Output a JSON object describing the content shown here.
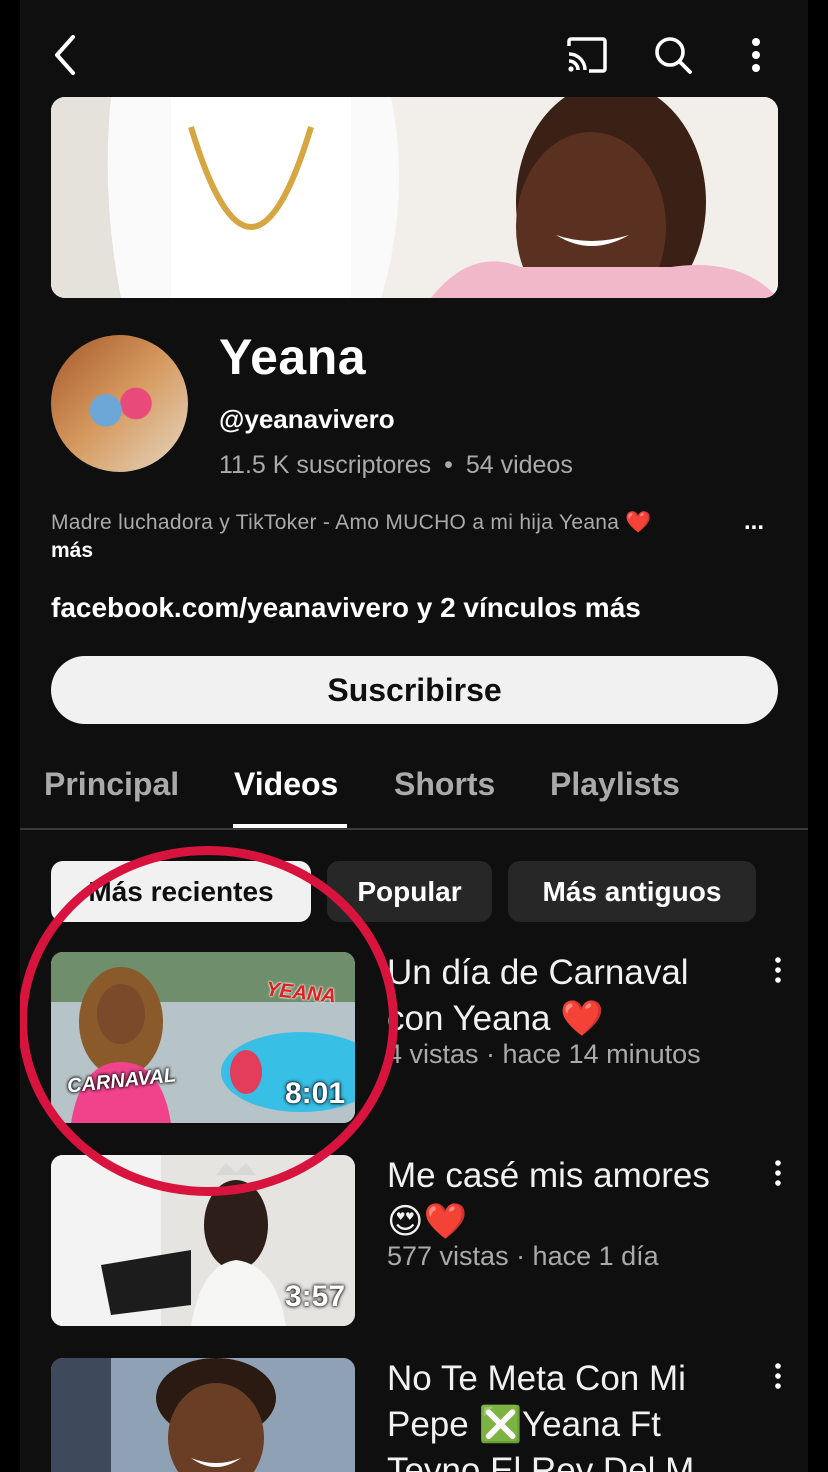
{
  "channel": {
    "name": "Yeana",
    "handle": "@yeanavivero",
    "subscribers": "11.5 K suscriptores",
    "separator": "•",
    "video_count": "54 videos",
    "description": "Madre luchadora y TikToker - Amo MUCHO a mi hija Yeana ❤️",
    "description_ellipsis": "...",
    "description_more": "más",
    "links_primary": "facebook.com/yeanavivero",
    "links_more": " y 2 vínculos más",
    "subscribe_label": "Suscribirse"
  },
  "tabs": [
    {
      "label": "Principal",
      "active": false
    },
    {
      "label": "Videos",
      "active": true
    },
    {
      "label": "Shorts",
      "active": false
    },
    {
      "label": "Playlists",
      "active": false
    }
  ],
  "chips": [
    {
      "label": "Más recientes",
      "selected": true
    },
    {
      "label": "Popular",
      "selected": false
    },
    {
      "label": "Más antiguos",
      "selected": false
    }
  ],
  "videos": [
    {
      "title": "Un día de Carnaval con Yeana ❤️",
      "meta": "4 vistas · hace 14 minutos",
      "duration": "8:01",
      "thumb_text_1": "CARNAVAL",
      "thumb_text_2": "YEANA"
    },
    {
      "title": "Me casé mis amores 😍❤️",
      "meta": "577 vistas · hace 1 día",
      "duration": "3:57"
    },
    {
      "title": "No Te Meta Con Mi Pepe ❎Yeana Ft Teyno El Rey Del M",
      "meta": "",
      "duration": ""
    }
  ],
  "icons": {
    "back": "chevron-left-icon",
    "cast": "cast-icon",
    "search": "search-icon",
    "more": "more-vert-icon"
  },
  "colors": {
    "background": "#0f0f0f",
    "highlight_ring": "#d8143e"
  }
}
